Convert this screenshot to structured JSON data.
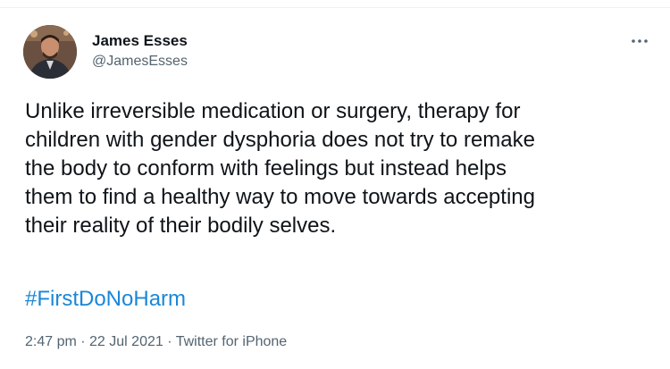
{
  "tweet": {
    "author": {
      "display_name": "James Esses",
      "handle": "@JamesEsses",
      "avatar_icon": "avatar-photo"
    },
    "more_icon": "more-dots-icon",
    "text": "Unlike irreversible medication or surgery, therapy for\nchildren with gender dysphoria does not try to remake\nthe body to conform with feelings but instead helps\nthem to find a healthy way to move towards accepting\ntheir reality of their bodily selves.",
    "hashtag": "#FirstDoNoHarm",
    "meta": {
      "time": "2:47 pm",
      "separator": " · ",
      "date": "22 Jul 2021",
      "source": "Twitter for iPhone"
    },
    "colors": {
      "text": "#0f1419",
      "secondary": "#536471",
      "link": "#1b87d8"
    }
  }
}
